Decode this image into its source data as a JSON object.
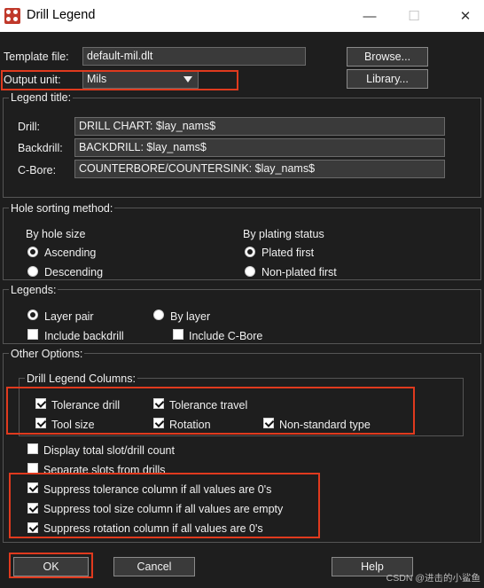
{
  "window": {
    "title": "Drill Legend",
    "minimize": "—",
    "maximize": "☐",
    "close": "✕"
  },
  "template": {
    "label": "Template file:",
    "value": "default-mil.dlt",
    "browse": "Browse..."
  },
  "output": {
    "label": "Output unit:",
    "value": "Mils",
    "library": "Library..."
  },
  "legend_title": {
    "group": "Legend title:",
    "drill_label": "Drill:",
    "drill_value": "DRILL CHART: $lay_nams$",
    "backdrill_label": "Backdrill:",
    "backdrill_value": "BACKDRILL: $lay_nams$",
    "cbore_label": "C-Bore:",
    "cbore_value": "COUNTERBORE/COUNTERSINK: $lay_nams$"
  },
  "hole_sorting": {
    "group": "Hole sorting method:",
    "by_size": "By hole size",
    "ascending": "Ascending",
    "descending": "Descending",
    "by_plating": "By plating status",
    "plated_first": "Plated first",
    "non_plated_first": "Non-plated first"
  },
  "legends": {
    "group": "Legends:",
    "layer_pair": "Layer pair",
    "by_layer": "By layer",
    "include_backdrill": "Include backdrill",
    "include_cbore": "Include C-Bore"
  },
  "other": {
    "group": "Other Options:",
    "columns_group": "Drill Legend Columns:",
    "tolerance_drill": "Tolerance drill",
    "tolerance_travel": "Tolerance travel",
    "tool_size": "Tool size",
    "rotation": "Rotation",
    "non_standard": "Non-standard type",
    "display_total": "Display total slot/drill count",
    "separate_slots": "Separate slots from drills",
    "suppress_tolerance": "Suppress tolerance column if all values are 0's",
    "suppress_tool_size": "Suppress tool size column if all values are empty",
    "suppress_rotation": "Suppress rotation column if all values are 0's"
  },
  "footer": {
    "ok": "OK",
    "cancel": "Cancel",
    "help": "Help"
  },
  "watermark": "CSDN @进击的小鲨鱼",
  "colors": {
    "background": "#1e1e1e",
    "highlight": "#e03a1e",
    "titlebar": "#ffffff"
  }
}
